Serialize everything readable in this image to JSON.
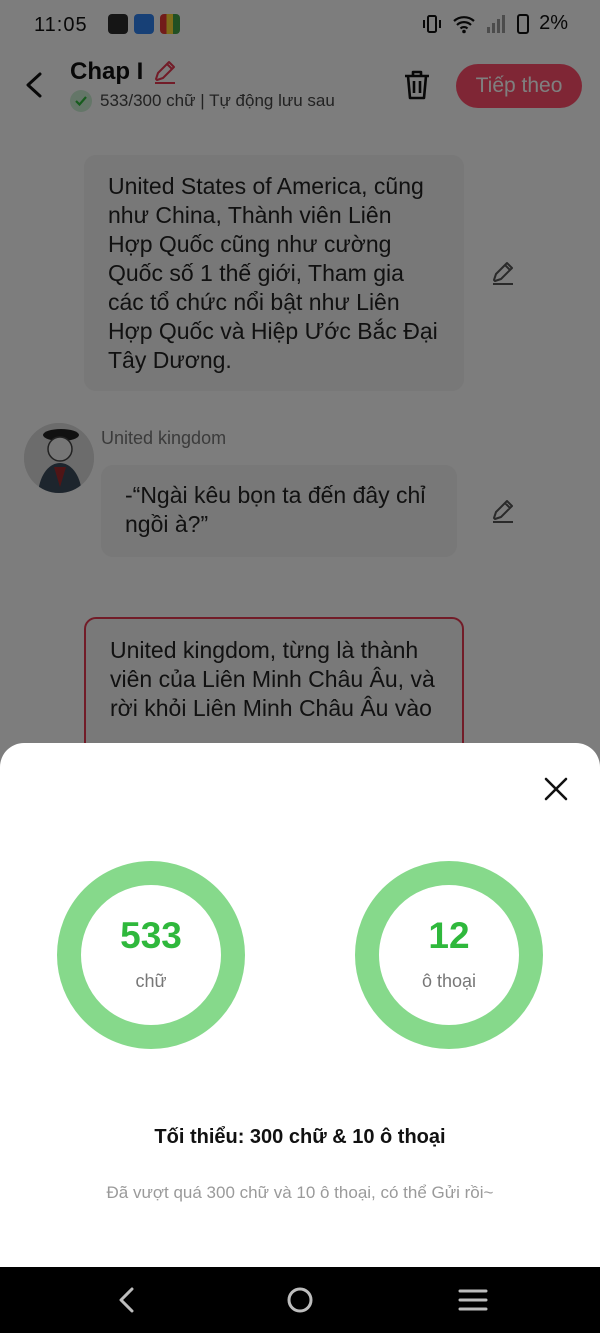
{
  "status_bar": {
    "time": "11:05",
    "battery": "2%",
    "app_icons": [
      "h-app-icon",
      "novel-toon-icon",
      "grid-app-icon"
    ]
  },
  "header": {
    "title": "Chap I",
    "save_status": "533/300 chữ | Tự động lưu sau",
    "next_label": "Tiếp theo",
    "accent_color": "#ff4d6a"
  },
  "messages": [
    {
      "text": "United States of America, cũng như China, Thành viên Liên Hợp Quốc cũng như cường Quốc số 1 thế giới, Tham gia các tổ chức nổi bật như Liên Hợp Quốc và Hiệp Ước Bắc Đại Tây Dương."
    },
    {
      "speaker": "United kingdom",
      "text": "-“Ngài kêu bọn ta đến đây chỉ ngồi à?”"
    },
    {
      "text": "United kingdom, từng là thành viên của Liên Minh Châu Âu, và rời khỏi Liên Minh Châu Âu vào"
    }
  ],
  "stats_sheet": {
    "words": {
      "value": "533",
      "label": "chữ"
    },
    "dialogues": {
      "value": "12",
      "label": "ô thoại"
    },
    "minimum": "Tối thiểu: 300 chữ & 10 ô thoại",
    "exceeded_message": "Đã vượt quá 300 chữ và 10 ô thoại, có thể Gửi rồi~",
    "ring_color": "#86d98b",
    "value_color": "#2fb83c"
  }
}
